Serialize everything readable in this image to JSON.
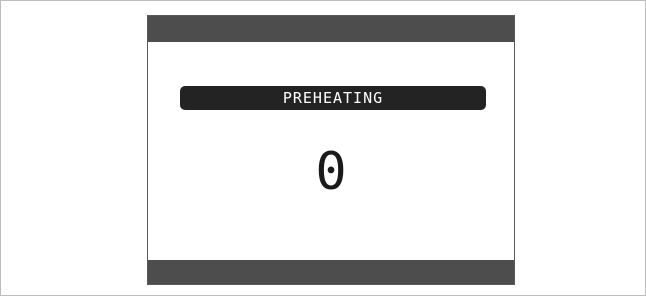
{
  "display": {
    "status": "PREHEATING",
    "value": "0"
  },
  "colors": {
    "bar": "#4d4d4d",
    "pill": "#232323",
    "pill_text": "#ffffff",
    "value_text": "#1a1a1a"
  }
}
